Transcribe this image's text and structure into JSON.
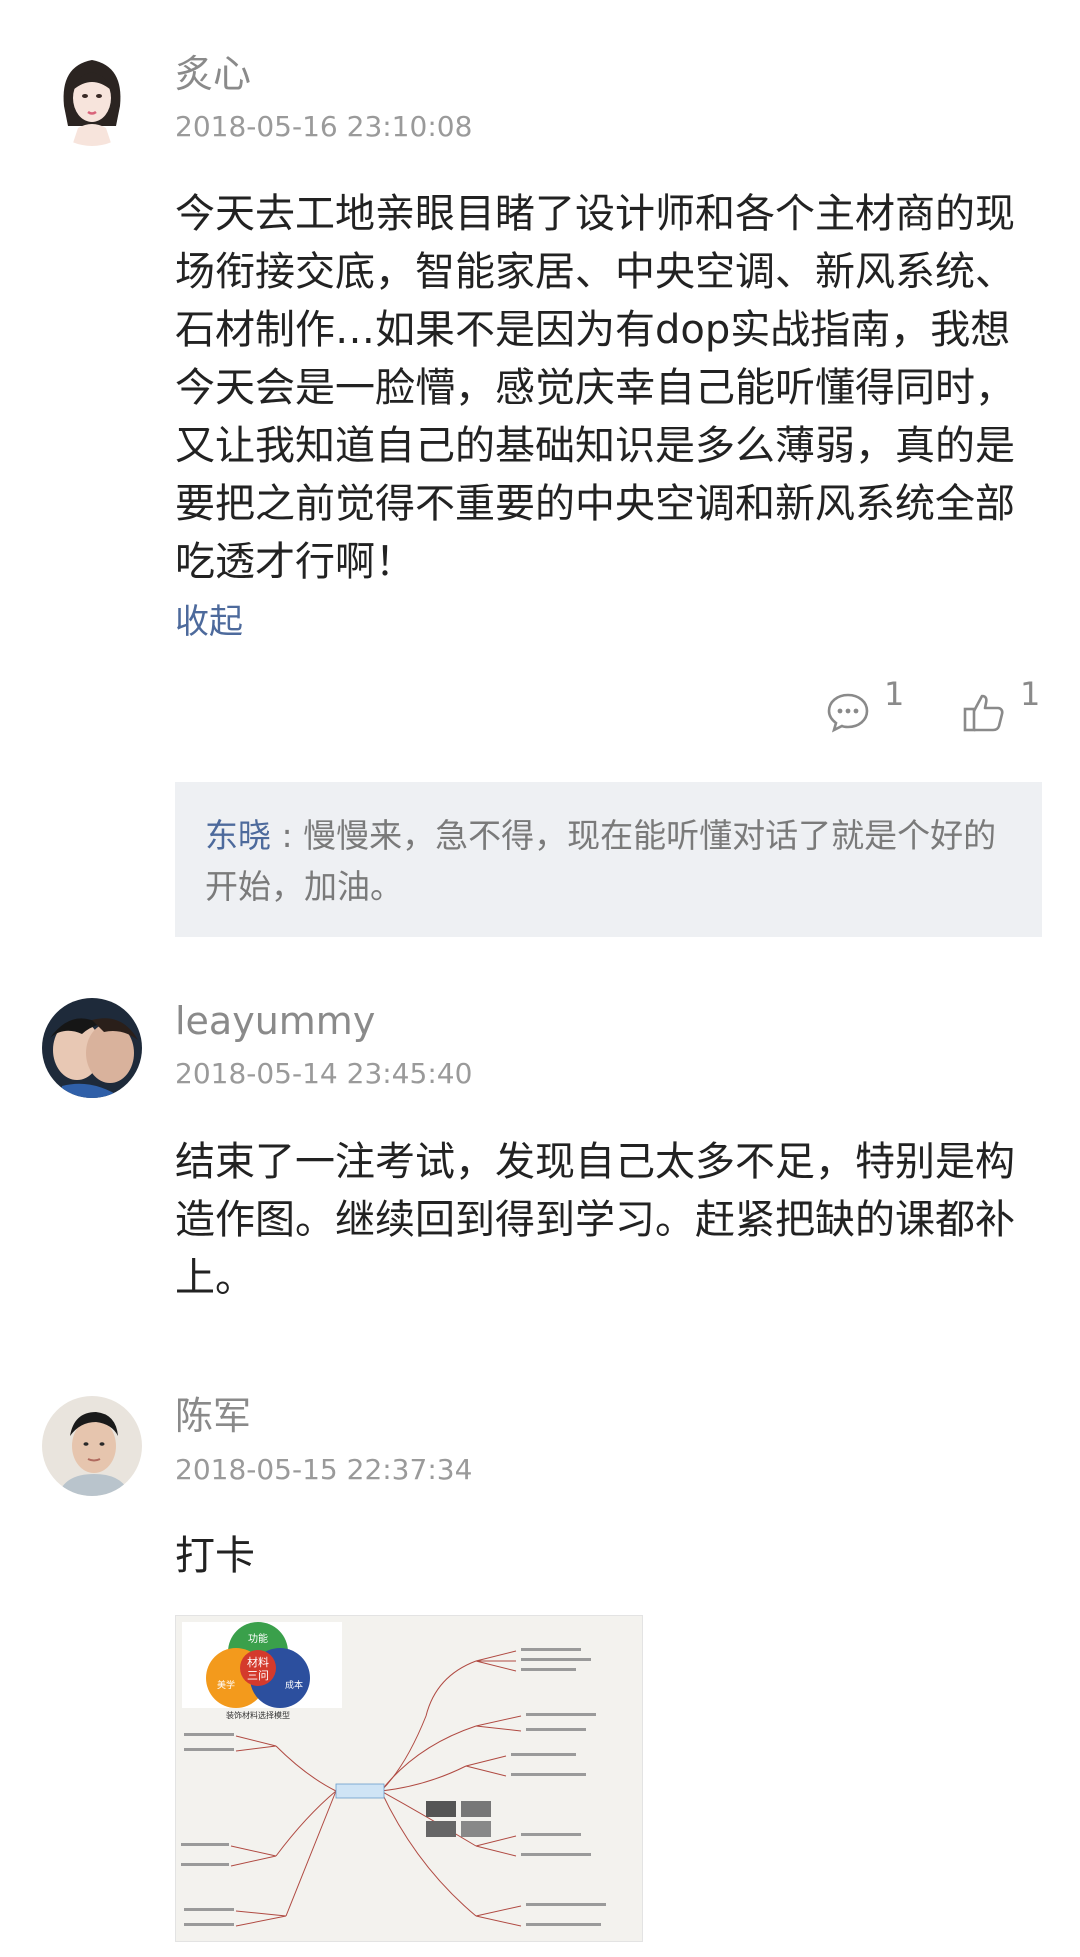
{
  "comments": [
    {
      "user": "炙心",
      "time": "2018-05-16 23:10:08",
      "text": "今天去工地亲眼目睹了设计师和各个主材商的现场衔接交底，智能家居、中央空调、新风系统、石材制作…如果不是因为有dop实战指南，我想今天会是一脸懵，感觉庆幸自己能听懂得同时，又让我知道自己的基础知识是多么薄弱，真的是要把之前觉得不重要的中央空调和新风系统全部吃透才行啊！",
      "collapse_label": "收起",
      "comment_count": "1",
      "like_count": "1",
      "reply": {
        "name": "东晓",
        "separator": " : ",
        "text": "慢慢来，急不得，现在能听懂对话了就是个好的开始，加油。"
      }
    },
    {
      "user": "leayummy",
      "time": "2018-05-14 23:45:40",
      "text": "结束了一注考试，发现自己太多不足，特别是构造作图。继续回到得到学习。赶紧把缺的课都补上。"
    },
    {
      "user": "陈军",
      "time": "2018-05-15 22:37:34",
      "text": "打卡",
      "image": {
        "labels": {
          "function": "功能",
          "material": "材料",
          "three_questions": "三问",
          "cost": "成本",
          "aesthetics": "美学",
          "model_title": "装饰材料选择模型"
        }
      }
    }
  ],
  "colors": {
    "link": "#4d6a9c",
    "reply_bg": "#eef0f3",
    "meta": "#9a9a9a"
  },
  "icons": [
    "comment-icon",
    "thumbs-up-icon"
  ]
}
